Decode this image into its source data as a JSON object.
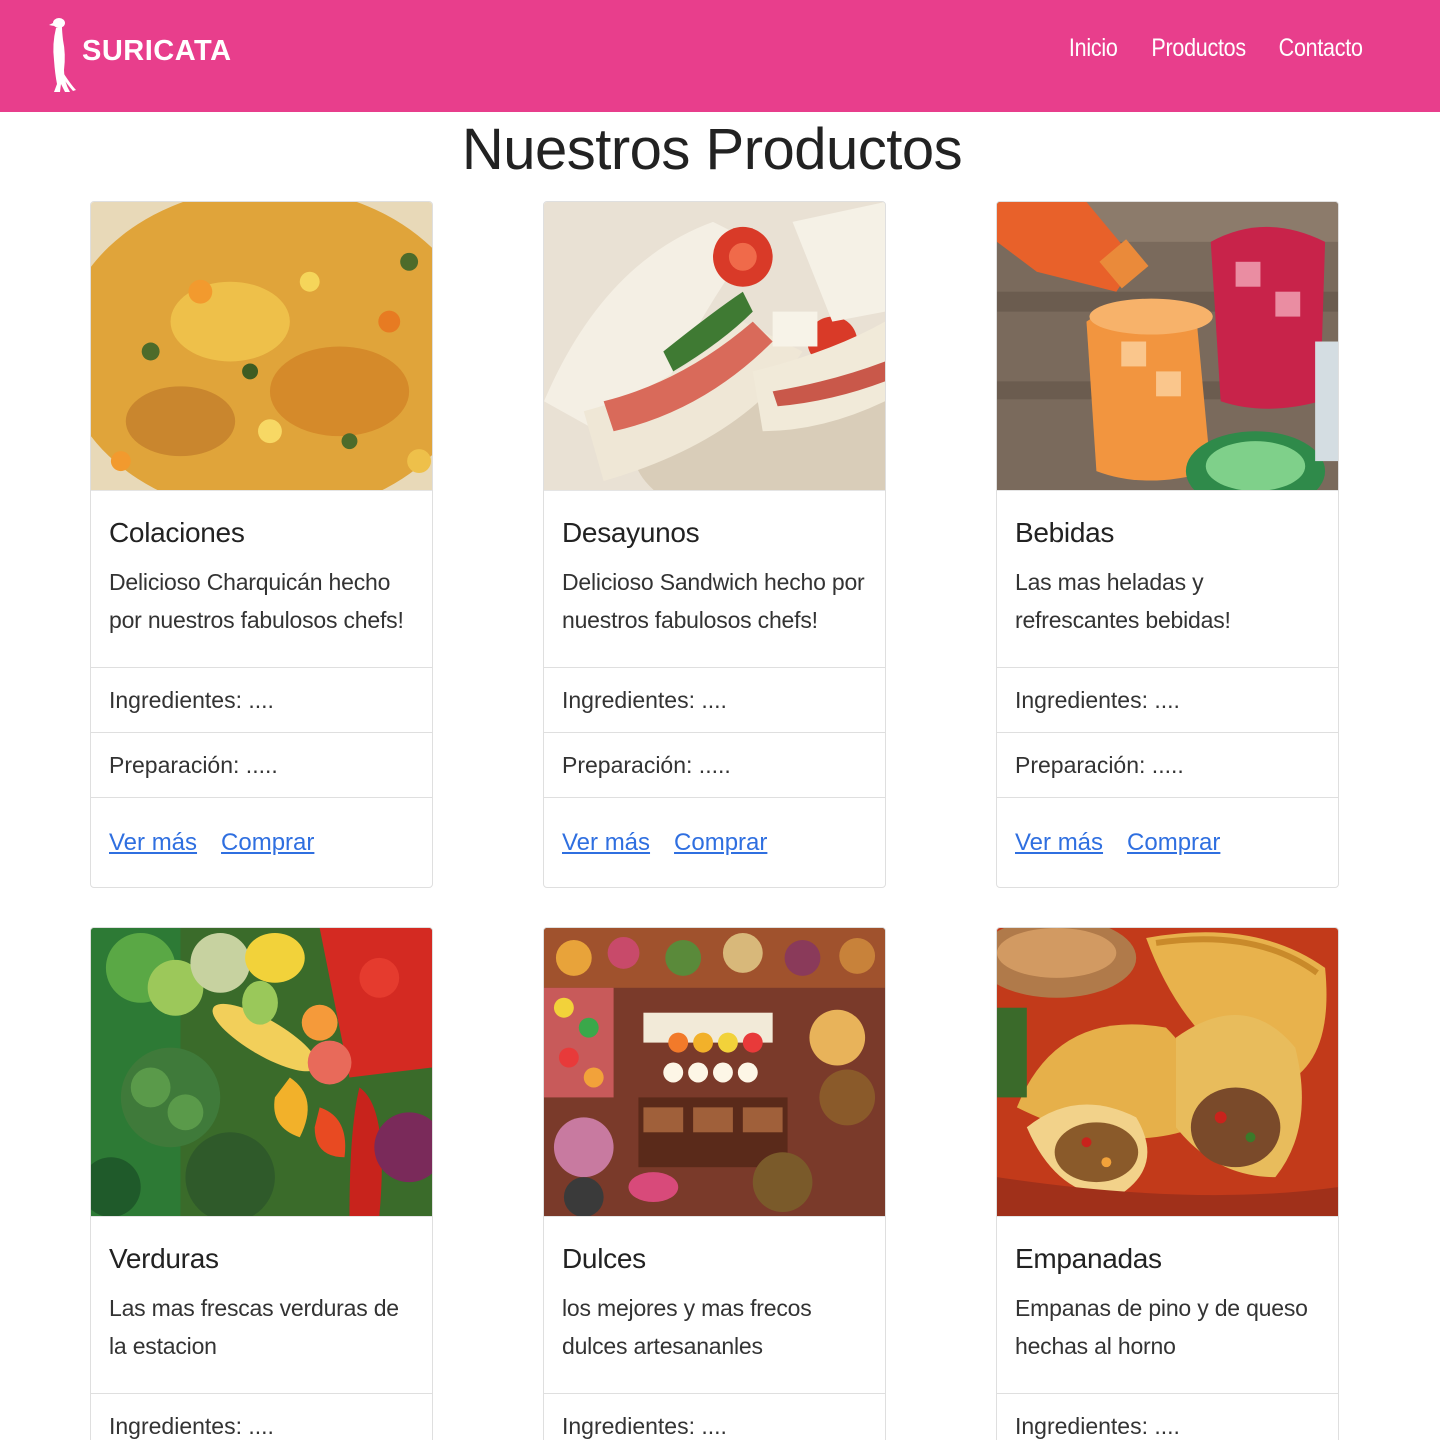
{
  "brand": {
    "name": "SURICATA",
    "logo_icon": "meerkat-icon"
  },
  "nav": [
    {
      "label": "Inicio"
    },
    {
      "label": "Productos"
    },
    {
      "label": "Contacto"
    }
  ],
  "page_title": "Nuestros Productos",
  "colors": {
    "navbar": "#e83e8c",
    "link": "#2f6fe0"
  },
  "products": [
    {
      "title": "Colaciones",
      "text": "Delicioso Charquicán hecho por nuestros fabulosos chefs!",
      "ingredients": "Ingredientes: ....",
      "preparation": "Preparación: .....",
      "more_label": "Ver más",
      "buy_label": "Comprar",
      "image": "charquican-photo"
    },
    {
      "title": "Desayunos",
      "text": "Delicioso Sandwich hecho por nuestros fabulosos chefs!",
      "ingredients": "Ingredientes: ....",
      "preparation": "Preparación: .....",
      "more_label": "Ver más",
      "buy_label": "Comprar",
      "image": "sandwich-photo"
    },
    {
      "title": "Bebidas",
      "text": "Las mas heladas y refrescantes bebidas!",
      "ingredients": "Ingredientes: ....",
      "preparation": "Preparación: .....",
      "more_label": "Ver más",
      "buy_label": "Comprar",
      "image": "drinks-photo"
    },
    {
      "title": "Verduras",
      "text": "Las mas frescas verduras de la estacion",
      "ingredients": "Ingredientes: ....",
      "image": "vegetables-photo"
    },
    {
      "title": "Dulces",
      "text": "los mejores y mas frecos dulces artesananles",
      "ingredients": "Ingredientes: ....",
      "image": "sweets-photo"
    },
    {
      "title": "Empanadas",
      "text": "Empanas de pino y de queso hechas al horno",
      "ingredients": "Ingredientes: ....",
      "image": "empanadas-photo"
    }
  ]
}
